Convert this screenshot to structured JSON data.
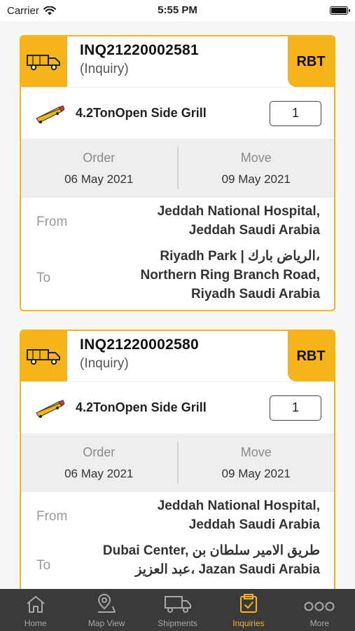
{
  "status_bar": {
    "carrier": "Carrier",
    "time": "5:55 PM"
  },
  "cards": [
    {
      "inquiry_number": "INQ21220002581",
      "inquiry_type": "(Inquiry)",
      "badge": "RBT",
      "vehicle": "4.2TonOpen Side Grill",
      "quantity": "1",
      "order_label": "Order",
      "order_date": "06 May 2021",
      "move_label": "Move",
      "move_date": "09 May 2021",
      "from_label": "From",
      "from_lines": [
        "Jeddah National Hospital,",
        "Jeddah Saudi Arabia"
      ],
      "to_label": "To",
      "to_lines": [
        "Riyadh Park | الرياض بارك،",
        "Northern Ring Branch Road,",
        "Riyadh Saudi Arabia"
      ]
    },
    {
      "inquiry_number": "INQ21220002580",
      "inquiry_type": "(Inquiry)",
      "badge": "RBT",
      "vehicle": "4.2TonOpen Side Grill",
      "quantity": "1",
      "order_label": "Order",
      "order_date": "06 May 2021",
      "move_label": "Move",
      "move_date": "09 May 2021",
      "from_label": "From",
      "from_lines": [
        "Jeddah National Hospital,",
        "Jeddah Saudi Arabia"
      ],
      "to_label": "To",
      "to_lines": [
        "Dubai Center, طريق الامير سلطان بن",
        "عبد العزيز، Jazan Saudi Arabia"
      ]
    }
  ],
  "tabbar": {
    "items": [
      {
        "label": "Home",
        "icon": "home-icon"
      },
      {
        "label": "Map View",
        "icon": "map-pin-icon"
      },
      {
        "label": "Shipments",
        "icon": "truck-icon"
      },
      {
        "label": "Inquiries",
        "icon": "box-check-icon"
      },
      {
        "label": "More",
        "icon": "more-dots-icon"
      }
    ],
    "active": "Inquiries"
  },
  "colors": {
    "accent": "#f5b419",
    "tabbar_bg": "#3a3a3a"
  }
}
